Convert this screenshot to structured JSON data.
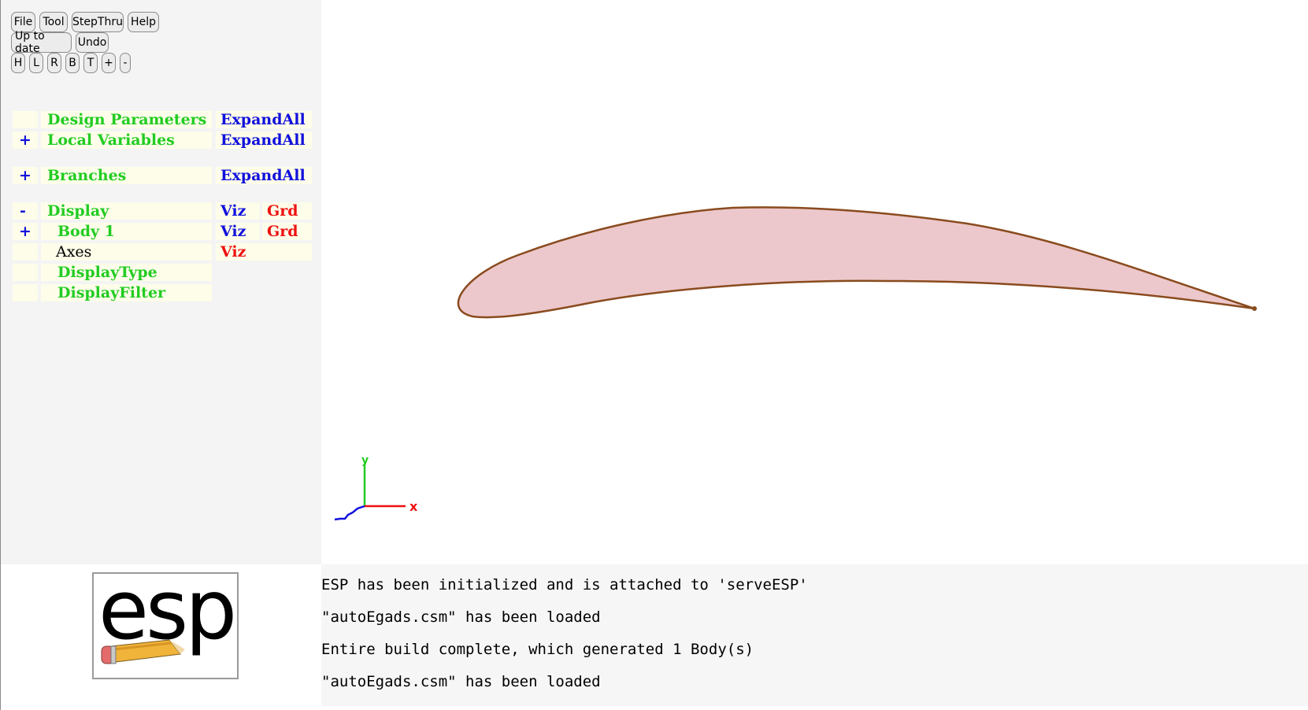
{
  "toolbar": {
    "file": "File",
    "tool": "Tool",
    "stepthru": "StepThru",
    "help": "Help",
    "uptodate": "Up to date",
    "undo": "Undo",
    "view_buttons": [
      "H",
      "L",
      "R",
      "B",
      "T",
      "+",
      "-"
    ]
  },
  "tree": {
    "design_parameters": {
      "label": "Design Parameters",
      "action": "ExpandAll"
    },
    "local_variables": {
      "toggle": "+",
      "label": "Local Variables",
      "action": "ExpandAll"
    },
    "branches": {
      "toggle": "+",
      "label": "Branches",
      "action": "ExpandAll"
    },
    "display": {
      "toggle": "-",
      "label": "Display",
      "viz": "Viz",
      "grd": "Grd"
    },
    "body1": {
      "toggle": "+",
      "label": "Body 1",
      "viz": "Viz",
      "grd": "Grd"
    },
    "axes": {
      "label": "Axes",
      "viz": "Viz"
    },
    "display_type": {
      "label": "DisplayType"
    },
    "display_filter": {
      "label": "DisplayFilter"
    }
  },
  "axes_labels": {
    "x": "x",
    "y": "y"
  },
  "logo_text": "esp",
  "messages": [
    "ESP has been initialized and is attached to 'serveESP'",
    "\"autoEgads.csm\" has been loaded",
    "Entire build complete, which generated 1 Body(s)",
    "\"autoEgads.csm\" has been loaded"
  ],
  "colors": {
    "tree_label": "#22cc22",
    "tree_action": "#1111dd",
    "grid_toggle": "#ee1111",
    "airfoil_fill": "#ecc8cc",
    "airfoil_edge": "#8a4b1e"
  }
}
